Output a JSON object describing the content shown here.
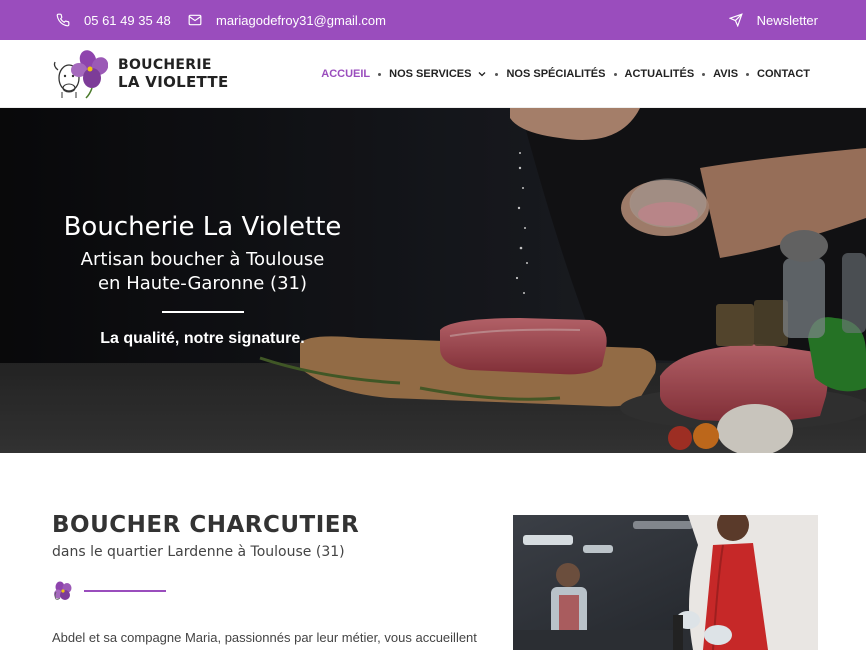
{
  "topbar": {
    "phone": "05 61 49 35 48",
    "email": "mariagodefroy31@gmail.com",
    "newsletter": "Newsletter",
    "color": "#9a4dbd"
  },
  "logo": {
    "line1": "BOUCHERIE",
    "line2": "LA VIOLETTE"
  },
  "nav": {
    "items": [
      {
        "label": "ACCUEIL",
        "active": true
      },
      {
        "label": "NOS SERVICES",
        "dropdown": true
      },
      {
        "label": "NOS SPÉCIALITÉS"
      },
      {
        "label": "ACTUALITÉS"
      },
      {
        "label": "AVIS"
      },
      {
        "label": "CONTACT"
      }
    ]
  },
  "hero": {
    "title": "Boucherie La Violette",
    "subtitle_line1": "Artisan boucher à Toulouse",
    "subtitle_line2": "en Haute-Garonne (31)",
    "tagline": "La qualité, notre signature."
  },
  "section": {
    "title": "BOUCHER CHARCUTIER",
    "subtitle": "dans le quartier Lardenne à Toulouse (31)",
    "paragraph": "Abdel et sa compagne Maria, passionnés par leur métier, vous accueillent"
  },
  "icons": {
    "phone": "phone-icon",
    "email": "envelope-icon",
    "newsletter": "paper-plane-icon",
    "dropdown": "chevron-down-icon",
    "divider": "violet-flower-icon"
  }
}
